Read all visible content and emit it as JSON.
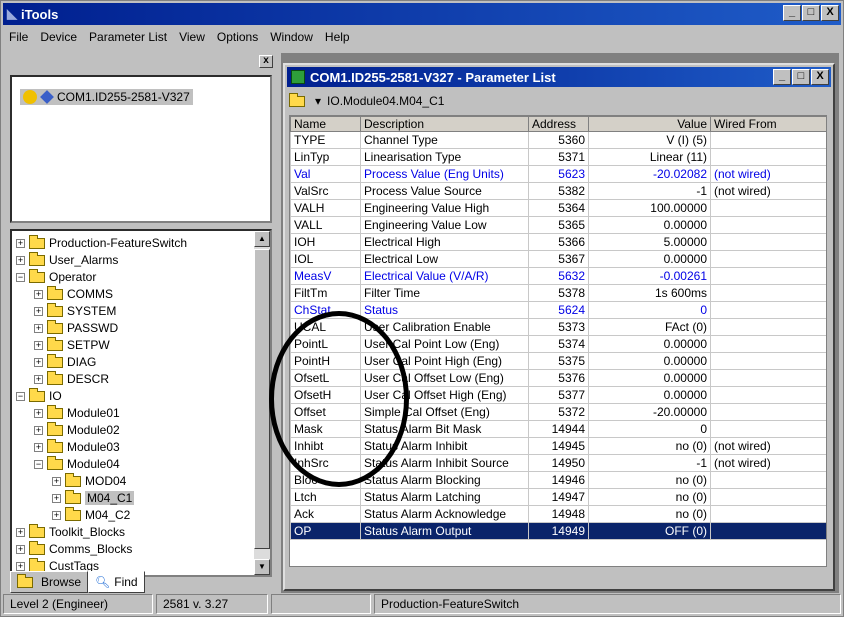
{
  "app": {
    "title": "iTools",
    "window_buttons": [
      "_",
      "□",
      "X"
    ]
  },
  "menu": [
    "File",
    "Device",
    "Parameter List",
    "View",
    "Options",
    "Window",
    "Help"
  ],
  "left": {
    "close": "x",
    "device": "COM1.ID255-2581-V327",
    "tree": [
      {
        "label": "Production-FeatureSwitch",
        "level": 0,
        "exp": "+"
      },
      {
        "label": "User_Alarms",
        "level": 0,
        "exp": "+"
      },
      {
        "label": "Operator",
        "level": 0,
        "exp": "−"
      },
      {
        "label": "COMMS",
        "level": 1,
        "exp": "+"
      },
      {
        "label": "SYSTEM",
        "level": 1,
        "exp": "+"
      },
      {
        "label": "PASSWD",
        "level": 1,
        "exp": "+"
      },
      {
        "label": "SETPW",
        "level": 1,
        "exp": "+"
      },
      {
        "label": "DIAG",
        "level": 1,
        "exp": "+"
      },
      {
        "label": "DESCR",
        "level": 1,
        "exp": "+"
      },
      {
        "label": "IO",
        "level": 0,
        "exp": "−"
      },
      {
        "label": "Module01",
        "level": 1,
        "exp": "+"
      },
      {
        "label": "Module02",
        "level": 1,
        "exp": "+"
      },
      {
        "label": "Module03",
        "level": 1,
        "exp": "+"
      },
      {
        "label": "Module04",
        "level": 1,
        "exp": "−"
      },
      {
        "label": "MOD04",
        "level": 2,
        "exp": "+"
      },
      {
        "label": "M04_C1",
        "level": 2,
        "exp": "+",
        "selected": true
      },
      {
        "label": "M04_C2",
        "level": 2,
        "exp": "+"
      },
      {
        "label": "Toolkit_Blocks",
        "level": 0,
        "exp": "+"
      },
      {
        "label": "Comms_Blocks",
        "level": 0,
        "exp": "+"
      },
      {
        "label": "CustTags",
        "level": 0,
        "exp": "+"
      }
    ],
    "tabs": [
      "Browse",
      "Find"
    ]
  },
  "paramwin": {
    "title": "COM1.ID255-2581-V327 - Parameter List",
    "path": "IO.Module04.M04_C1",
    "columns": [
      "Name",
      "Description",
      "Address",
      "Value",
      "Wired From"
    ],
    "rows": [
      [
        "TYPE",
        "Channel Type",
        "5360",
        "V (I) (5)",
        "",
        "normal"
      ],
      [
        "LinTyp",
        "Linearisation Type",
        "5371",
        "Linear (11)",
        "",
        "normal"
      ],
      [
        "Val",
        "Process Value (Eng Units)",
        "5623",
        "-20.02082",
        "(not wired)",
        "blue"
      ],
      [
        "ValSrc",
        "Process Value Source",
        "5382",
        "-1",
        "(not wired)",
        "normal"
      ],
      [
        "VALH",
        "Engineering Value High",
        "5364",
        "100.00000",
        "",
        "normal"
      ],
      [
        "VALL",
        "Engineering Value Low",
        "5365",
        "0.00000",
        "",
        "normal"
      ],
      [
        "IOH",
        "Electrical High",
        "5366",
        "5.00000",
        "",
        "normal"
      ],
      [
        "IOL",
        "Electrical Low",
        "5367",
        "0.00000",
        "",
        "normal"
      ],
      [
        "MeasV",
        "Electrical Value (V/A/R)",
        "5632",
        "-0.00261",
        "",
        "blue"
      ],
      [
        "FiltTm",
        "Filter Time",
        "5378",
        "1s 600ms",
        "",
        "normal"
      ],
      [
        "ChStat",
        "Status",
        "5624",
        "0",
        "",
        "blue"
      ],
      [
        "UCAL",
        "User Calibration Enable",
        "5373",
        "FAct (0)",
        "",
        "normal"
      ],
      [
        "PointL",
        "User Cal Point Low (Eng)",
        "5374",
        "0.00000",
        "",
        "normal"
      ],
      [
        "PointH",
        "User Cal Point High (Eng)",
        "5375",
        "0.00000",
        "",
        "normal"
      ],
      [
        "OfsetL",
        "User Cal Offset Low (Eng)",
        "5376",
        "0.00000",
        "",
        "normal"
      ],
      [
        "OfsetH",
        "User Cal Offset High (Eng)",
        "5377",
        "0.00000",
        "",
        "normal"
      ],
      [
        "Offset",
        "Simple Cal Offset (Eng)",
        "5372",
        "-20.00000",
        "",
        "normal"
      ],
      [
        "Mask",
        "Status Alarm Bit Mask",
        "14944",
        "0",
        "",
        "normal"
      ],
      [
        "Inhibt",
        "Status Alarm Inhibit",
        "14945",
        "no (0)",
        "(not wired)",
        "normal"
      ],
      [
        "InhSrc",
        "Status Alarm Inhibit Source",
        "14950",
        "-1",
        "(not wired)",
        "normal"
      ],
      [
        "Bloc",
        "Status Alarm Blocking",
        "14946",
        "no (0)",
        "",
        "normal"
      ],
      [
        "Ltch",
        "Status Alarm Latching",
        "14947",
        "no (0)",
        "",
        "normal"
      ],
      [
        "Ack",
        "Status Alarm Acknowledge",
        "14948",
        "no (0)",
        "",
        "normal"
      ],
      [
        "OP",
        "Status Alarm Output",
        "14949",
        "OFF (0)",
        "",
        "hl"
      ]
    ]
  },
  "status": {
    "level": "Level 2 (Engineer)",
    "version": "2581 v. 3.27",
    "block": "Production-FeatureSwitch"
  }
}
